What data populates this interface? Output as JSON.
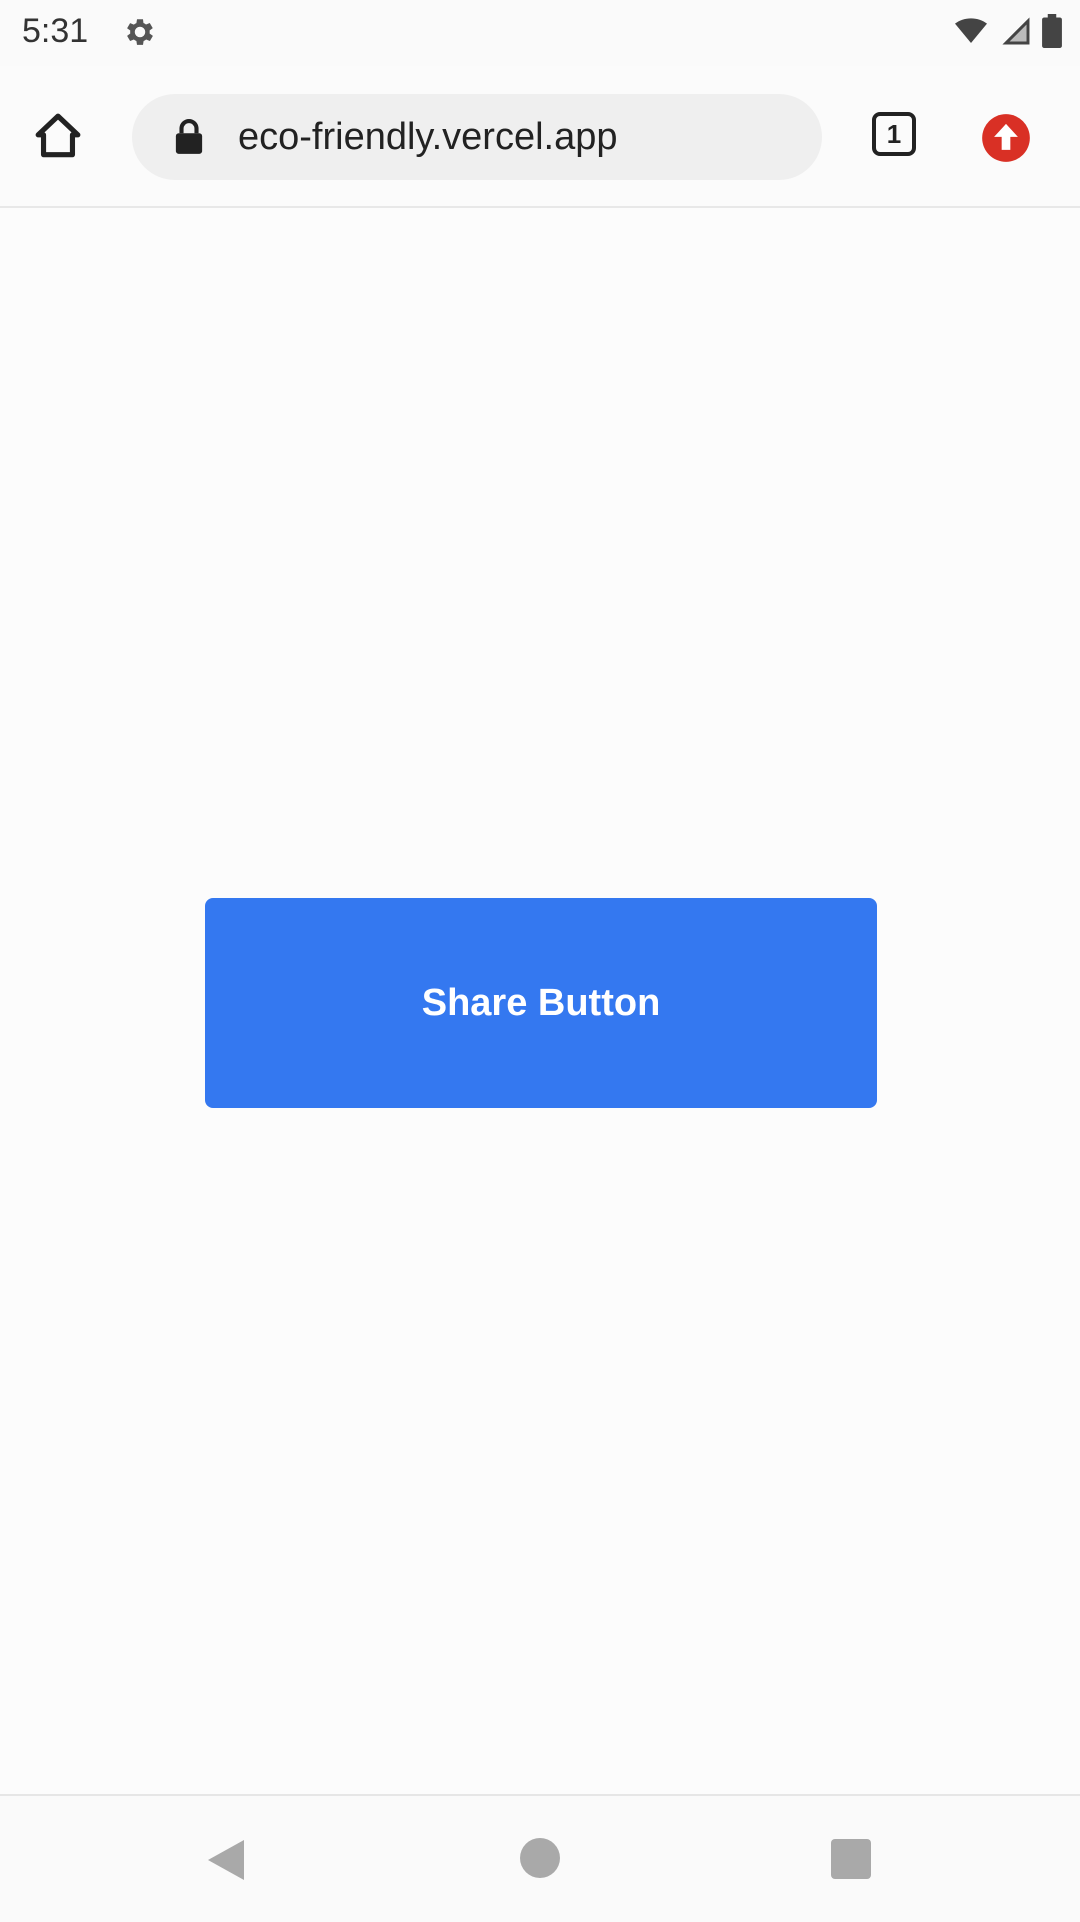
{
  "status_bar": {
    "time": "5:31",
    "icons": [
      "gear-icon",
      "wifi-icon",
      "signal-icon",
      "battery-icon"
    ]
  },
  "browser": {
    "url": "eco-friendly.vercel.app",
    "tab_count": "1",
    "icons": [
      "home-icon",
      "lock-icon",
      "tab-switcher-icon",
      "update-icon"
    ],
    "update_color": "#d93025"
  },
  "page": {
    "share_button_label": "Share Button",
    "accent_color": "#3478f0"
  },
  "nav_bar": {
    "icons": [
      "back-icon",
      "home-circle-icon",
      "recents-icon"
    ]
  }
}
